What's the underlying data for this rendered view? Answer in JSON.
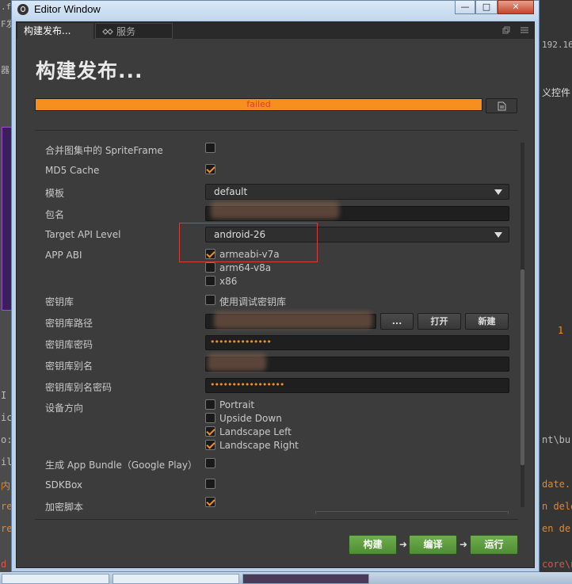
{
  "window": {
    "title": "Editor Window",
    "min_glyph": "—",
    "max_glyph": "□",
    "close_glyph": "✕"
  },
  "tabs": [
    {
      "label": "构建发布..."
    },
    {
      "label": "服务"
    }
  ],
  "panel": {
    "heading": "构建发布...",
    "progress": {
      "value": 1.0,
      "status_text": "failed",
      "fill_color": "#f5901f",
      "text_color": "#e43b2e"
    }
  },
  "form": {
    "merge_spriteframe": {
      "label": "合并图集中的 SpriteFrame",
      "checked": false
    },
    "md5_cache": {
      "label": "MD5 Cache",
      "checked": true
    },
    "template": {
      "label": "模板",
      "value": "default"
    },
    "package_name": {
      "label": "包名",
      "value": ""
    },
    "target_api_level": {
      "label": "Target API Level",
      "value": "android-26"
    },
    "app_abi": {
      "label": "APP ABI",
      "options": [
        {
          "label": "armeabi-v7a",
          "checked": true
        },
        {
          "label": "arm64-v8a",
          "checked": false
        },
        {
          "label": "x86",
          "checked": false
        }
      ]
    },
    "keystore": {
      "label": "密钥库",
      "option_label": "使用调试密钥库",
      "checked": false
    },
    "keystore_path": {
      "label": "密钥库路径",
      "browse_label": "...",
      "open_label": "打开",
      "new_label": "新建"
    },
    "keystore_password": {
      "label": "密钥库密码",
      "value": "••••••••••••••"
    },
    "keystore_alias": {
      "label": "密钥库别名"
    },
    "keystore_alias_password": {
      "label": "密钥库别名密码",
      "value": "•••••••••••••••••"
    },
    "orientation": {
      "label": "设备方向",
      "options": [
        {
          "label": "Portrait",
          "checked": false
        },
        {
          "label": "Upside Down",
          "checked": false
        },
        {
          "label": "Landscape Left",
          "checked": true
        },
        {
          "label": "Landscape Right",
          "checked": true
        }
      ]
    },
    "app_bundle": {
      "label": "生成 App Bundle（Google Play）",
      "checked": false
    },
    "sdkbox": {
      "label": "SDKBox",
      "checked": false
    },
    "encrypt_script": {
      "label": "加密脚本",
      "checked": true
    }
  },
  "actions": {
    "build": "构建",
    "compile": "编译",
    "run": "运行",
    "arrow_glyph": "➜"
  },
  "background": {
    "left_snippets": [
      ".fi",
      "F发",
      "器"
    ],
    "right_ip": "192.16",
    "right_label": "义控件",
    "right_number": "1",
    "right_log": [
      "nt\\bu",
      "date.",
      "n dele",
      "en de",
      "core\\na"
    ],
    "left_log": [
      "I",
      "ic",
      "o:\\",
      "il",
      "内",
      "re",
      "re",
      "d D"
    ]
  },
  "colors": {
    "accent": "#f5901f",
    "build_green": "#5a9a3c",
    "highlight_red": "#d93a3a"
  }
}
